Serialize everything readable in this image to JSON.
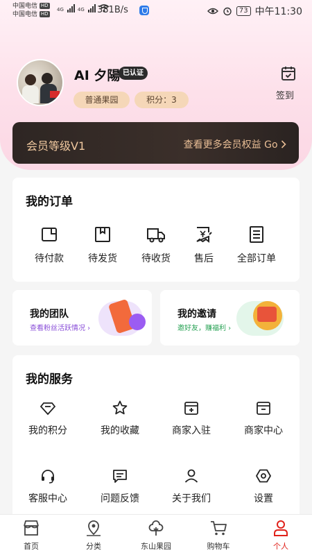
{
  "status_bar": {
    "carrier1": "中国电信",
    "carrier2": "中国电信",
    "hd": "HD",
    "net1": "4G",
    "net2": "4G",
    "speed": "381B/s",
    "battery": "73",
    "time": "中午11:30"
  },
  "profile": {
    "nickname": "AI 夕陽",
    "verified_badge": "已认证",
    "level_tag": "普通果园",
    "points_tag": "积分：3",
    "signin_label": "签到"
  },
  "member": {
    "title": "会员等级V1",
    "link_label": "查看更多会员权益 Go"
  },
  "orders": {
    "title": "我的订单",
    "items": [
      {
        "label": "待付款",
        "icon": "wallet-icon"
      },
      {
        "label": "待发货",
        "icon": "package-icon"
      },
      {
        "label": "待收货",
        "icon": "truck-icon"
      },
      {
        "label": "售后",
        "icon": "refund-icon"
      },
      {
        "label": "全部订单",
        "icon": "order-list-icon"
      }
    ]
  },
  "promo": {
    "team_title": "我的团队",
    "team_sub": "查看粉丝活跃情况",
    "invite_title": "我的邀请",
    "invite_sub": "邀好友，赚福利"
  },
  "services": {
    "title": "我的服务",
    "items": [
      {
        "label": "我的积分",
        "icon": "diamond-icon"
      },
      {
        "label": "我的收藏",
        "icon": "star-icon"
      },
      {
        "label": "商家入驻",
        "icon": "store-add-icon"
      },
      {
        "label": "商家中心",
        "icon": "store-icon"
      },
      {
        "label": "客服中心",
        "icon": "headset-icon"
      },
      {
        "label": "问题反馈",
        "icon": "feedback-icon"
      },
      {
        "label": "关于我们",
        "icon": "user-icon"
      },
      {
        "label": "设置",
        "icon": "settings-icon"
      }
    ]
  },
  "tabbar": {
    "items": [
      {
        "label": "首页",
        "icon": "home-shop-icon"
      },
      {
        "label": "分类",
        "icon": "location-icon"
      },
      {
        "label": "东山果园",
        "icon": "tree-icon"
      },
      {
        "label": "购物车",
        "icon": "cart-icon"
      },
      {
        "label": "个人",
        "icon": "person-icon"
      }
    ],
    "active_index": 4,
    "active_color": "#e0211a"
  },
  "colors": {
    "accent": "#e0211a",
    "member_gold": "#f1c9a0",
    "tag_bg": "#f5d7b8",
    "team_purple": "#8a4fd8",
    "invite_green": "#2aa356"
  }
}
